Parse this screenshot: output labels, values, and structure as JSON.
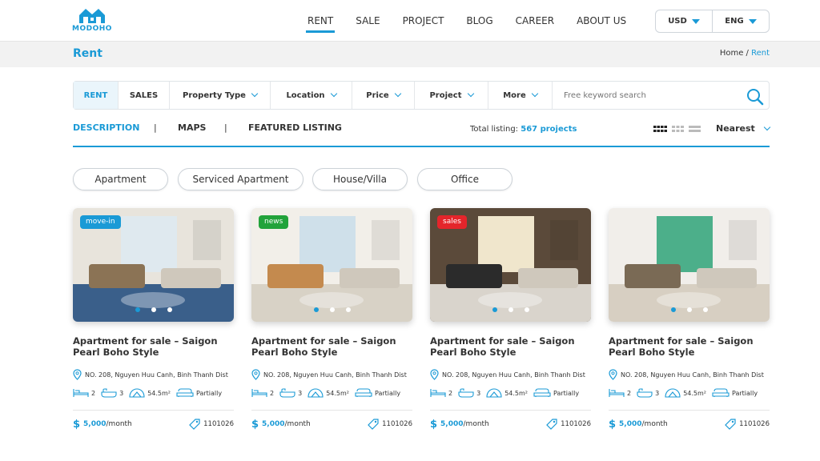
{
  "brand": {
    "name": "MODOHO",
    "color": "#1a9ad6"
  },
  "nav": [
    {
      "label": "RENT",
      "active": true
    },
    {
      "label": "SALE"
    },
    {
      "label": "PROJECT"
    },
    {
      "label": "BLOG"
    },
    {
      "label": "CAREER"
    },
    {
      "label": "ABOUT US"
    }
  ],
  "currency": "USD",
  "language": "ENG",
  "page_title": "Rent",
  "breadcrumb": {
    "home": "Home",
    "sep": " / ",
    "current": "Rent"
  },
  "search": {
    "tabs": [
      "RENT",
      "SALES"
    ],
    "filters": [
      "Property Type",
      "Location",
      "Price",
      "Project",
      "More"
    ],
    "placeholder": "Free keyword search"
  },
  "view_tabs": [
    "DESCRIPTION",
    "MAPS",
    "FEATURED LISTING"
  ],
  "tab_separator": "|",
  "total": {
    "label": "Total listing: ",
    "value": "567 projects"
  },
  "sort": "Nearest",
  "chips": [
    "Apartment",
    "Serviced Apartment",
    "House/Villa",
    "Office"
  ],
  "listings": [
    {
      "badge": "move-in",
      "badge_color": "#1a9ad6",
      "title": "Apartment for sale – Saigon Pearl Boho Style",
      "address": "NO. 208, Nguyen Huu Canh, Binh Thanh Dist",
      "beds": "2",
      "baths": "3",
      "area": "54.5m²",
      "furnish": "Partially",
      "price": "5,000",
      "per": "/month",
      "code": "1101026",
      "active_dot": 0
    },
    {
      "badge": "news",
      "badge_color": "#22a33b",
      "title": "Apartment for sale – Saigon Pearl Boho Style",
      "address": "NO. 208, Nguyen Huu Canh, Binh Thanh Dist",
      "beds": "2",
      "baths": "3",
      "area": "54.5m²",
      "furnish": "Partially",
      "price": "5,000",
      "per": "/month",
      "code": "1101026",
      "active_dot": 0
    },
    {
      "badge": "sales",
      "badge_color": "#e4252b",
      "title": "Apartment for sale – Saigon Pearl Boho Style",
      "address": "NO. 208, Nguyen Huu Canh, Binh Thanh Dist",
      "beds": "2",
      "baths": "3",
      "area": "54.5m²",
      "furnish": "Partially",
      "price": "5,000",
      "per": "/month",
      "code": "1101026",
      "active_dot": 0
    },
    {
      "badge": "",
      "badge_color": "",
      "title": "Apartment for sale – Saigon Pearl Boho Style",
      "address": "NO. 208, Nguyen Huu Canh, Binh Thanh Dist",
      "beds": "2",
      "baths": "3",
      "area": "54.5m²",
      "furnish": "Partially",
      "price": "5,000",
      "per": "/month",
      "code": "1101026",
      "active_dot": 0
    }
  ],
  "icons": {
    "location": "map-pin-icon",
    "bed": "bed-icon",
    "bath": "bathtub-icon",
    "area": "area-icon",
    "furniture": "sofa-icon",
    "tag": "tag-icon"
  }
}
